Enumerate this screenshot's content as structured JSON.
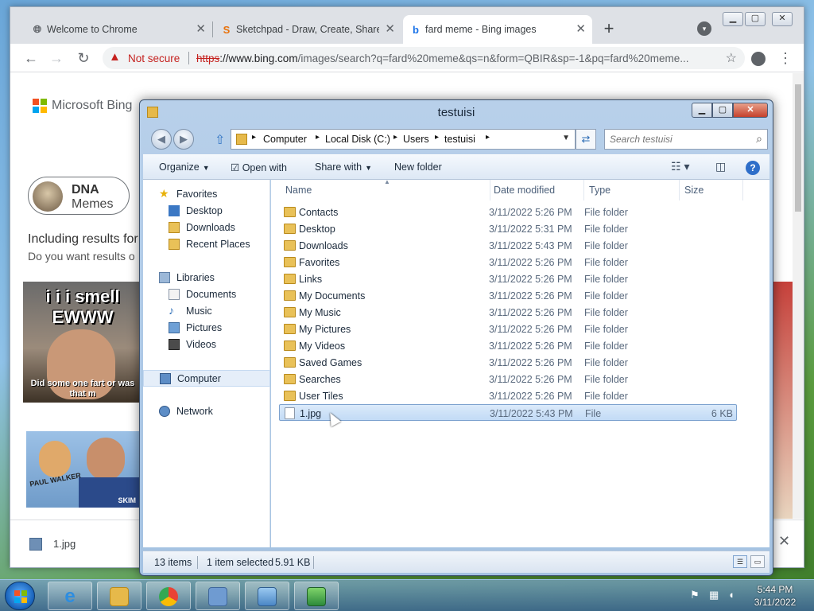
{
  "chrome": {
    "tabs": [
      {
        "label": "Welcome to Chrome",
        "icon": "globe-icon"
      },
      {
        "label": "Sketchpad - Draw, Create, Share!",
        "icon": "sketchpad-icon"
      },
      {
        "label": "fard meme - Bing images",
        "icon": "bing-icon"
      }
    ],
    "new_tab": "+",
    "security_label": "Not secure",
    "url_scheme": "https",
    "url_rest": "://www.bing.com",
    "url_path": "/images/search?q=fard%20meme&qs=n&form=QBIR&sp=-1&pq=fard%20meme..."
  },
  "bing": {
    "logo": "Microsoft Bing",
    "chip_title": "DNA",
    "chip_subtitle": "Memes",
    "including": "Including results for",
    "do_you_want": "Do you want results o",
    "meme1_top": "i i i smell EWWW",
    "meme1_bottom": "Did some one fart or was that m",
    "meme2_text": "PAUL WALKER",
    "meme2_corner": "SKIM"
  },
  "download_bar": {
    "filename": "1.jpg"
  },
  "explorer": {
    "title": "testuisi",
    "breadcrumb": [
      "Computer",
      "Local Disk (C:)",
      "Users",
      "testuisi"
    ],
    "search_placeholder": "Search testuisi",
    "commands": {
      "organize": "Organize",
      "open_with": "Open with",
      "share_with": "Share with",
      "new_folder": "New folder"
    },
    "nav": {
      "favorites": "Favorites",
      "fav_items": [
        "Desktop",
        "Downloads",
        "Recent Places"
      ],
      "libraries": "Libraries",
      "lib_items": [
        "Documents",
        "Music",
        "Pictures",
        "Videos"
      ],
      "computer": "Computer",
      "network": "Network"
    },
    "columns": {
      "name": "Name",
      "date": "Date modified",
      "type": "Type",
      "size": "Size"
    },
    "files": [
      {
        "name": "Contacts",
        "date": "3/11/2022 5:26 PM",
        "type": "File folder",
        "size": ""
      },
      {
        "name": "Desktop",
        "date": "3/11/2022 5:31 PM",
        "type": "File folder",
        "size": ""
      },
      {
        "name": "Downloads",
        "date": "3/11/2022 5:43 PM",
        "type": "File folder",
        "size": ""
      },
      {
        "name": "Favorites",
        "date": "3/11/2022 5:26 PM",
        "type": "File folder",
        "size": ""
      },
      {
        "name": "Links",
        "date": "3/11/2022 5:26 PM",
        "type": "File folder",
        "size": ""
      },
      {
        "name": "My Documents",
        "date": "3/11/2022 5:26 PM",
        "type": "File folder",
        "size": ""
      },
      {
        "name": "My Music",
        "date": "3/11/2022 5:26 PM",
        "type": "File folder",
        "size": ""
      },
      {
        "name": "My Pictures",
        "date": "3/11/2022 5:26 PM",
        "type": "File folder",
        "size": ""
      },
      {
        "name": "My Videos",
        "date": "3/11/2022 5:26 PM",
        "type": "File folder",
        "size": ""
      },
      {
        "name": "Saved Games",
        "date": "3/11/2022 5:26 PM",
        "type": "File folder",
        "size": ""
      },
      {
        "name": "Searches",
        "date": "3/11/2022 5:26 PM",
        "type": "File folder",
        "size": ""
      },
      {
        "name": "User Tiles",
        "date": "3/11/2022 5:26 PM",
        "type": "File folder",
        "size": ""
      },
      {
        "name": "1.jpg",
        "date": "3/11/2022 5:43 PM",
        "type": "File",
        "size": "6 KB",
        "selected": true
      }
    ],
    "status": {
      "items": "13 items",
      "selected": "1 item selected",
      "size": "5.91 KB"
    }
  },
  "taskbar": {
    "apps": [
      "internet-explorer",
      "windows-explorer",
      "chrome",
      "control-panel",
      "picture-viewer",
      "remote-desktop"
    ],
    "time": "5:44 PM",
    "date": "3/11/2022"
  }
}
